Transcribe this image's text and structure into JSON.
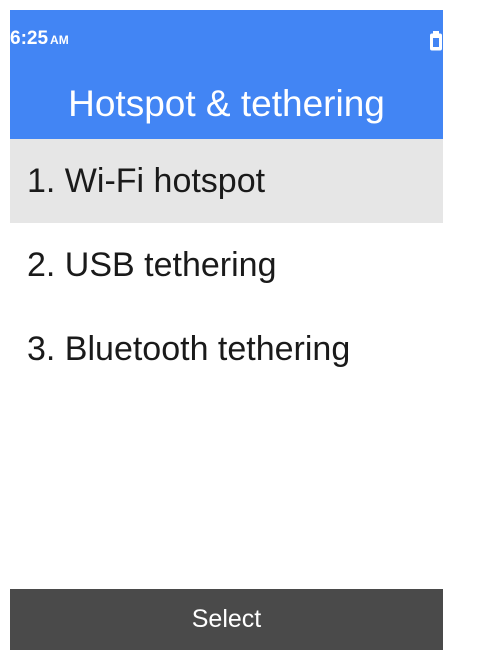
{
  "status_bar": {
    "time": "6:25",
    "ampm": "AM",
    "battery_icon": "battery-icon"
  },
  "header": {
    "title": "Hotspot & tethering"
  },
  "menu": {
    "items": [
      {
        "label": "1. Wi-Fi hotspot",
        "selected": true
      },
      {
        "label": "2. USB tethering",
        "selected": false
      },
      {
        "label": "3. Bluetooth tethering",
        "selected": false
      }
    ]
  },
  "softkey": {
    "center_label": "Select"
  },
  "colors": {
    "header_bg": "#4285f4",
    "selected_bg": "#e6e6e6",
    "softkey_bg": "#4a4a4a"
  }
}
